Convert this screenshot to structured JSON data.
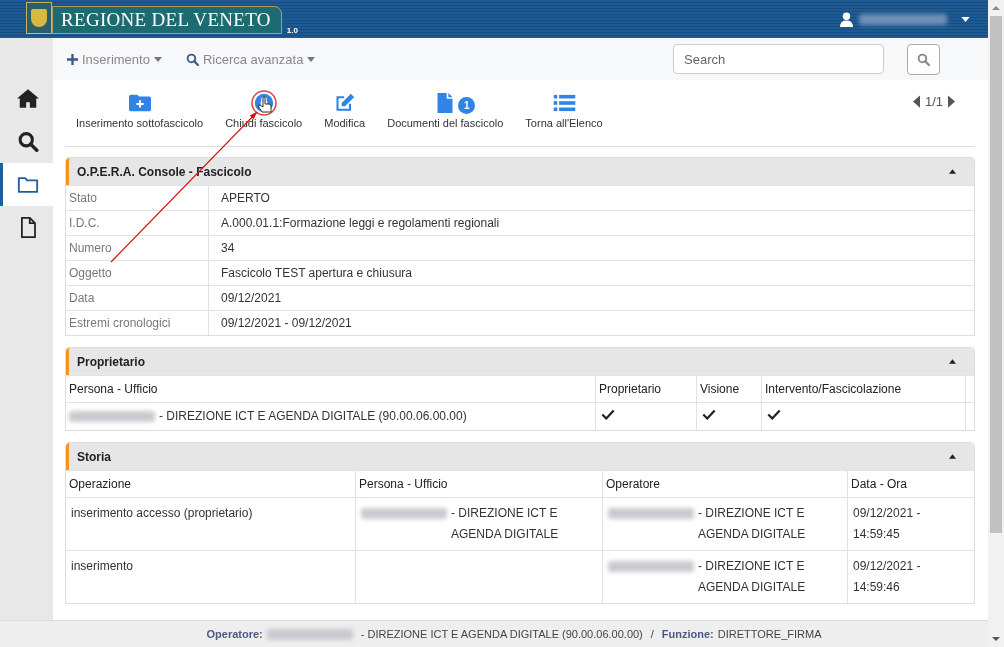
{
  "header": {
    "logo_text": "REGIONE DEL VENETO",
    "version": "1.0",
    "user": {
      "redacted": true
    }
  },
  "nav": [
    {
      "label": "Inserimento",
      "kind": "plus"
    },
    {
      "label": "Ricerca avanzata",
      "kind": "search"
    }
  ],
  "search": {
    "placeholder": "Search"
  },
  "sidebar": {
    "items": [
      {
        "kind": "home",
        "selected": false
      },
      {
        "kind": "search",
        "selected": false
      },
      {
        "kind": "folder",
        "selected": true
      },
      {
        "kind": "file",
        "selected": false
      }
    ]
  },
  "actions": [
    {
      "kind": "folder-plus",
      "label": "Inserimento sottofascicolo"
    },
    {
      "kind": "lock",
      "label": "Chiudi fascicolo"
    },
    {
      "kind": "edit",
      "label": "Modifica"
    },
    {
      "kind": "file",
      "label": "Documenti del fascicolo",
      "badge": "1"
    },
    {
      "kind": "list",
      "label": "Torna all'Elenco"
    }
  ],
  "pager": "1/1",
  "annotation": {
    "kind": "arrow"
  },
  "fascicolo": {
    "title": "O.P.E.R.A. Console - Fascicolo",
    "expanded": true,
    "rows": [
      {
        "label": "Stato",
        "value": "APERTO"
      },
      {
        "label": "I.D.C.",
        "value": "A.000.01.1:Formazione leggi e regolamenti regionali"
      },
      {
        "label": "Numero",
        "value": "34"
      },
      {
        "label": "Oggetto",
        "value": "Fascicolo TEST apertura e chiusura"
      },
      {
        "label": "Data",
        "value": "09/12/2021"
      },
      {
        "label": "Estremi cronologici",
        "value": "09/12/2021 - 09/12/2021"
      }
    ]
  },
  "proprietario": {
    "title": "Proprietario",
    "expanded": true,
    "columns": [
      "Persona - Ufficio",
      "Proprietario",
      "Visione",
      "Intervento/Fascicolazione"
    ],
    "rows": [
      {
        "persona": {
          "redacted": true,
          "text": "- DIREZIONE ICT E AGENDA DIGITALE  (90.00.06.00.00)"
        },
        "proprietario": true,
        "visione": true,
        "intervento": true
      }
    ]
  },
  "storia": {
    "title": "Storia",
    "expanded": true,
    "columns": [
      "Operazione",
      "Persona - Ufficio",
      "Operatore",
      "Data - Ora"
    ],
    "rows": [
      {
        "operazione": "inserimento accesso  (proprietario)",
        "persona": {
          "redacted": true,
          "text": "- DIREZIONE ICT E AGENDA DIGITALE"
        },
        "operatore": {
          "redacted": true,
          "text": "- DIREZIONE ICT E AGENDA DIGITALE"
        },
        "data": "09/12/2021 - 14:59:45"
      },
      {
        "operazione": "inserimento",
        "operatore": {
          "redacted": true,
          "text": "- DIREZIONE ICT E AGENDA DIGITALE"
        },
        "data": "09/12/2021 - 14:59:46"
      }
    ]
  },
  "footer": {
    "operatore_label": "Operatore:",
    "operatore": {
      "redacted": true,
      "text": "- DIREZIONE ICT E AGENDA DIGITALE (90.00.06.00.00)"
    },
    "separator": "/",
    "funzione_label": "Funzione:",
    "funzione": "DIRETTORE_FIRMA"
  }
}
